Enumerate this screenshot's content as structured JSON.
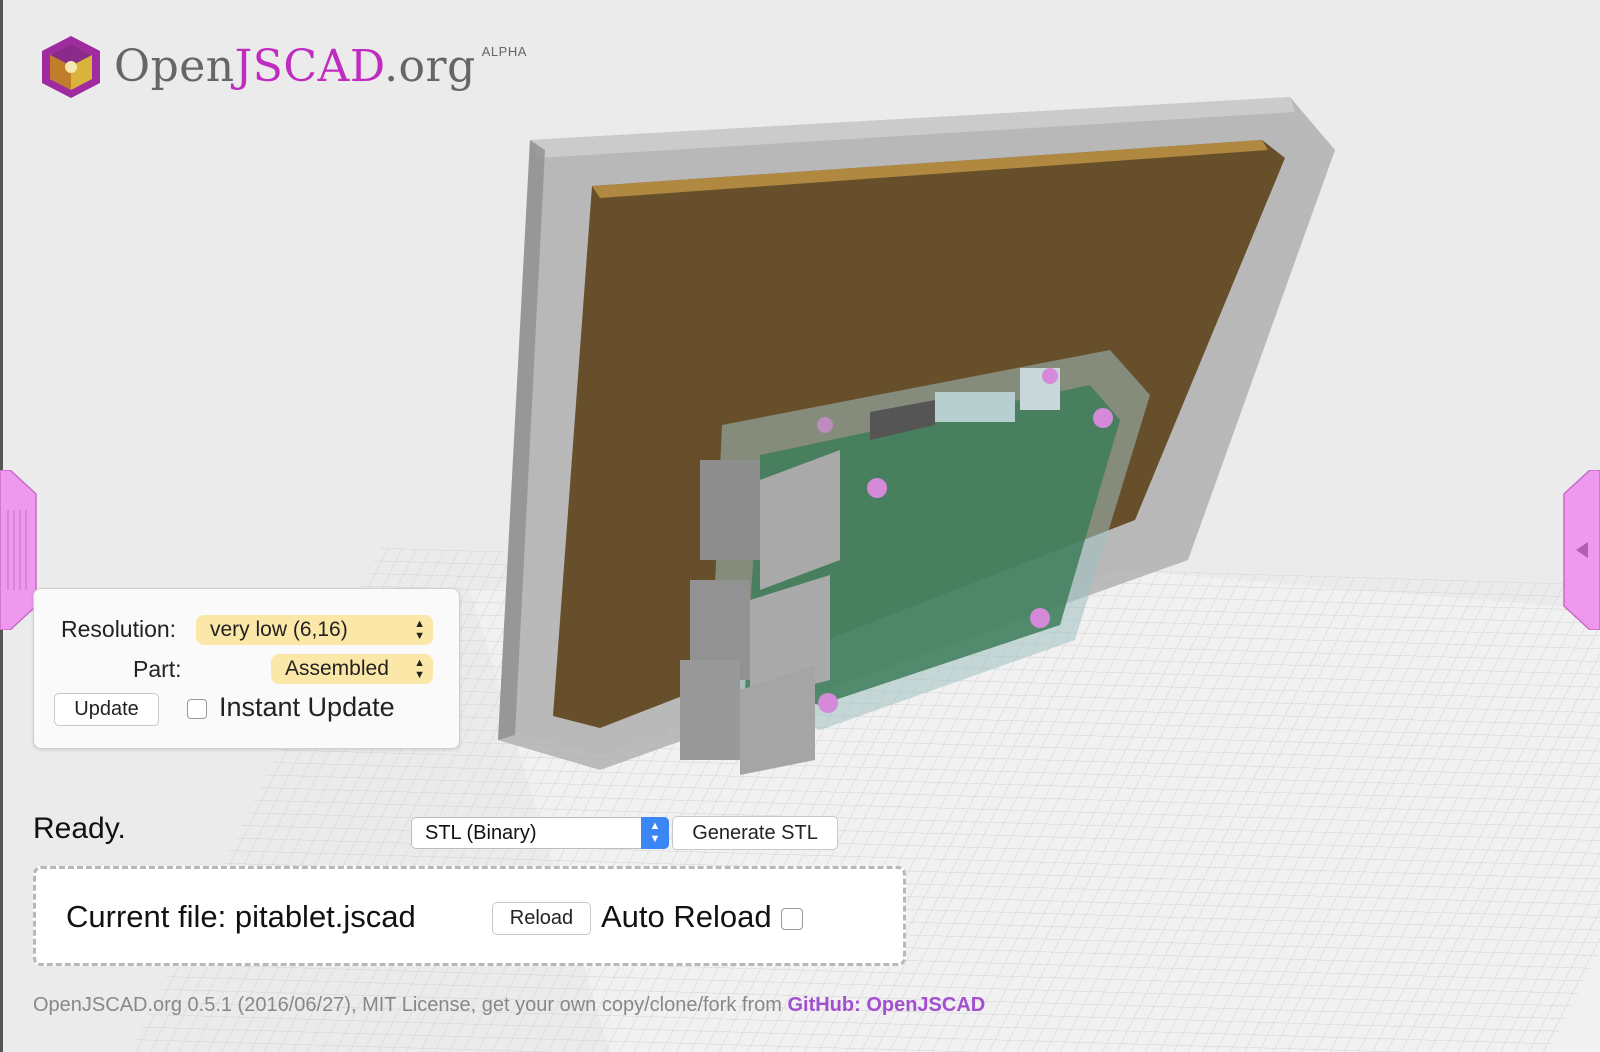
{
  "logo": {
    "text_prefix": "Open",
    "text_accent": "JSCAD",
    "text_suffix": ".org",
    "superscript": "ALPHA"
  },
  "parameters": {
    "resolution_label": "Resolution:",
    "resolution_value": "very low (6,16)",
    "part_label": "Part:",
    "part_value": "Assembled",
    "update_button": "Update",
    "instant_update_label": "Instant Update",
    "instant_update_checked": false
  },
  "status": "Ready.",
  "export": {
    "format_value": "STL (Binary)",
    "generate_button": "Generate STL"
  },
  "file": {
    "current_file_text": "Current file: pitablet.jscad",
    "reload_button": "Reload",
    "auto_reload_label": "Auto Reload",
    "auto_reload_checked": false
  },
  "footer": {
    "text": "OpenJSCAD.org 0.5.1 (2016/06/27), MIT License, get your own copy/clone/fork from ",
    "link_text": "GitHub: OpenJSCAD"
  },
  "colors": {
    "accent": "#c02cc0",
    "tab": "#ee98ee",
    "board": "#684f2b",
    "pcb": "#3d7d59",
    "selection_bg": "#fbe8a8",
    "link": "#a24fd0"
  }
}
